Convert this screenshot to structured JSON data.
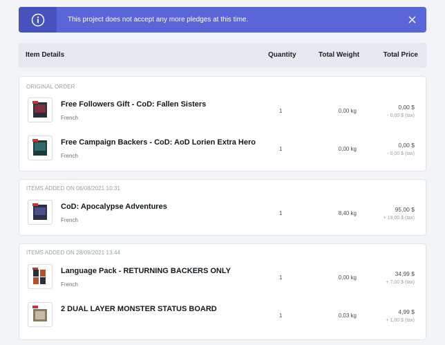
{
  "banner": {
    "message": "This project does not accept any more pledges at this time."
  },
  "table": {
    "headers": {
      "item": "Item Details",
      "quantity": "Quantity",
      "weight": "Total Weight",
      "price": "Total Price"
    }
  },
  "groups": [
    {
      "label": "ORIGINAL ORDER",
      "items": [
        {
          "name": "Free Followers Gift - CoD: Fallen Sisters",
          "language": "French",
          "quantity": "1",
          "weight": "0,00 kg",
          "price": "0,00 $",
          "tax": "- 0,00 $ (tax)"
        },
        {
          "name": "Free Campaign Backers - CoD: AoD Lorien Extra Hero",
          "language": "French",
          "quantity": "1",
          "weight": "0,00 kg",
          "price": "0,00 $",
          "tax": "- 0,00 $ (tax)"
        }
      ]
    },
    {
      "label": "ITEMS ADDED ON 06/08/2021 10:31",
      "items": [
        {
          "name": "CoD: Apocalypse Adventures",
          "language": "French",
          "quantity": "1",
          "weight": "8,40 kg",
          "price": "95,00 $",
          "tax": "+ 19,00 $ (tax)"
        }
      ]
    },
    {
      "label": "ITEMS ADDED ON 28/09/2021 13:44",
      "items": [
        {
          "name": "Language Pack - RETURNING BACKERS ONLY",
          "language": "French",
          "quantity": "1",
          "weight": "0,00 kg",
          "price": "34,99 $",
          "tax": "+ 7,00 $ (tax)"
        },
        {
          "name": "2 DUAL LAYER MONSTER STATUS BOARD",
          "language": "",
          "quantity": "1",
          "weight": "0,03 kg",
          "price": "4,99 $",
          "tax": "+ 1,00 $ (tax)"
        }
      ]
    }
  ],
  "colors": {
    "banner": "#5a66d8",
    "banner_icon_box": "#4652bd",
    "header_bg": "#e7e9f0"
  },
  "icons": {
    "banner_info": "info-circle-icon",
    "banner_close": "close-icon"
  }
}
